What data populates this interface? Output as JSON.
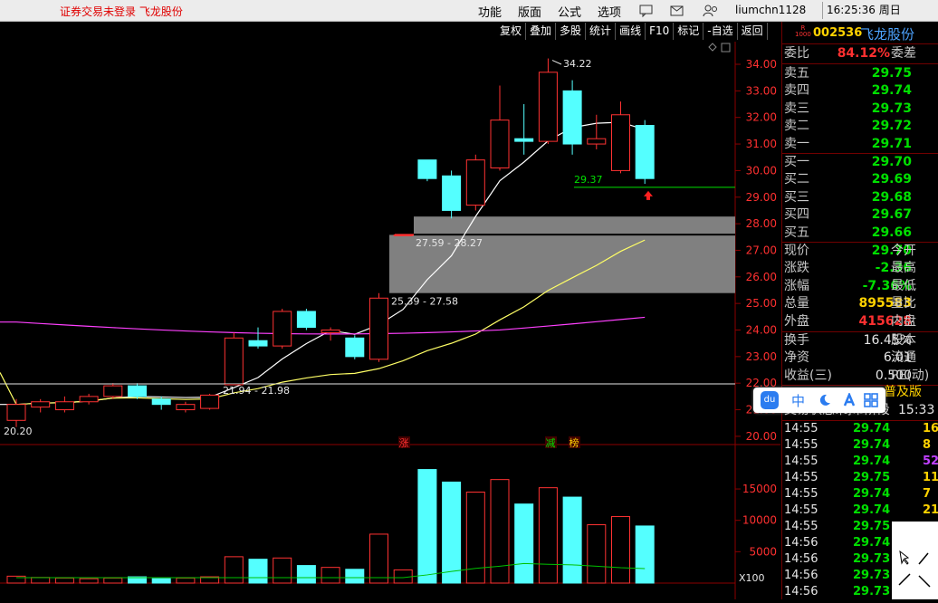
{
  "topbar": {
    "notice": "证券交易未登录",
    "stock_name": "飞龙股份",
    "menu": [
      "功能",
      "版面",
      "公式",
      "选项"
    ],
    "user": "liumchn1128",
    "time": "16:25:36",
    "weekday": "周日"
  },
  "toolbar": [
    "复权",
    "叠加",
    "多股",
    "统计",
    "画线",
    "F10",
    "标记",
    "-自选",
    "返回"
  ],
  "quote": {
    "badge_r": "R",
    "badge_num": "1000",
    "code": "002536",
    "name": "飞龙股份",
    "weibi_label": "委比",
    "weibi_value": "84.12%",
    "weicha_label": "委差",
    "asks": [
      {
        "label": "卖五",
        "price": "29.75"
      },
      {
        "label": "卖四",
        "price": "29.74"
      },
      {
        "label": "卖三",
        "price": "29.73"
      },
      {
        "label": "卖二",
        "price": "29.72"
      },
      {
        "label": "卖一",
        "price": "29.71"
      }
    ],
    "bids": [
      {
        "label": "买一",
        "price": "29.70"
      },
      {
        "label": "买二",
        "price": "29.69"
      },
      {
        "label": "买三",
        "price": "29.68"
      },
      {
        "label": "买四",
        "price": "29.67"
      },
      {
        "label": "买五",
        "price": "29.66"
      }
    ],
    "stats": [
      {
        "label": "现价",
        "value": "29.70",
        "label2": "今开",
        "color": "#00e000"
      },
      {
        "label": "涨跌",
        "value": "-2.36",
        "label2": "最高",
        "color": "#00e000"
      },
      {
        "label": "涨幅",
        "value": "-7.36%",
        "label2": "最低",
        "color": "#00e000"
      },
      {
        "label": "总量",
        "value": "895583",
        "label2": "量比",
        "color": "#ffd200"
      },
      {
        "label": "外盘",
        "value": "415628",
        "label2": "内盘",
        "color": "#ff3030"
      }
    ],
    "stats2": [
      {
        "label": "换手",
        "value": "16.45%",
        "label2": "股本"
      },
      {
        "label": "净资",
        "value": "6.01",
        "label2": "流通"
      },
      {
        "label": "收益(三)",
        "value": "0.500",
        "label2": "PE(动)"
      }
    ],
    "info_tail": "普及版",
    "trade_status": "交易状态:闭市阶段",
    "trade_time": "15:33"
  },
  "ticks": [
    {
      "time": "14:55",
      "price": "29.74",
      "vol": "16",
      "vcolor": "#ffd200"
    },
    {
      "time": "14:55",
      "price": "29.74",
      "vol": "8",
      "vcolor": "#ffd200"
    },
    {
      "time": "14:55",
      "price": "29.74",
      "vol": "52",
      "vcolor": "#c040ff"
    },
    {
      "time": "14:55",
      "price": "29.75",
      "vol": "11",
      "vcolor": "#ffd200"
    },
    {
      "time": "14:55",
      "price": "29.74",
      "vol": "7",
      "vcolor": "#ffd200"
    },
    {
      "time": "14:55",
      "price": "29.74",
      "vol": "21",
      "vcolor": "#ffd200"
    },
    {
      "time": "14:55",
      "price": "29.75",
      "vol": "",
      "vcolor": "#ffd200"
    },
    {
      "time": "14:56",
      "price": "29.74",
      "vol": "",
      "vcolor": "#ffd200"
    },
    {
      "time": "14:56",
      "price": "29.73",
      "vol": "",
      "vcolor": "#ffd200"
    },
    {
      "time": "14:56",
      "price": "29.73",
      "vol": "",
      "vcolor": "#ffd200"
    },
    {
      "time": "14:56",
      "price": "29.73",
      "vol": "",
      "vcolor": "#ffd200"
    }
  ],
  "ime": {
    "logo": "du",
    "lang": "中"
  },
  "chart_data": {
    "type": "candlestick",
    "price_axis_ticks": [
      "34.00",
      "33.00",
      "32.00",
      "31.00",
      "30.00",
      "29.00",
      "28.00",
      "27.00",
      "26.00",
      "25.00",
      "24.00",
      "23.00",
      "22.00",
      "21.00",
      "20.00"
    ],
    "volume_axis_ticks": [
      "15000",
      "10000",
      "5000"
    ],
    "volume_unit": "X100",
    "candles": [
      {
        "o": 20.6,
        "c": 21.2,
        "h": 21.4,
        "l": 20.35,
        "v": 1100
      },
      {
        "o": 21.1,
        "c": 21.3,
        "h": 21.4,
        "l": 20.9,
        "v": 900
      },
      {
        "o": 21.0,
        "c": 21.3,
        "h": 21.5,
        "l": 20.9,
        "v": 800
      },
      {
        "o": 21.3,
        "c": 21.5,
        "h": 21.6,
        "l": 21.2,
        "v": 700
      },
      {
        "o": 21.5,
        "c": 21.9,
        "h": 22.0,
        "l": 21.4,
        "v": 800
      },
      {
        "o": 21.9,
        "c": 21.5,
        "h": 22.0,
        "l": 21.4,
        "v": 1000
      },
      {
        "o": 21.4,
        "c": 21.2,
        "h": 21.5,
        "l": 21.0,
        "v": 700
      },
      {
        "o": 21.0,
        "c": 21.2,
        "h": 21.3,
        "l": 20.9,
        "v": 800
      },
      {
        "o": 21.05,
        "c": 21.55,
        "h": 21.6,
        "l": 21.0,
        "v": 1000
      },
      {
        "o": 21.94,
        "c": 23.7,
        "h": 23.9,
        "l": 21.98,
        "v": 4200
      },
      {
        "o": 23.6,
        "c": 23.4,
        "h": 24.1,
        "l": 23.3,
        "v": 3800
      },
      {
        "o": 23.4,
        "c": 24.7,
        "h": 24.8,
        "l": 23.3,
        "v": 4000
      },
      {
        "o": 24.7,
        "c": 24.1,
        "h": 24.8,
        "l": 24.0,
        "v": 2800
      },
      {
        "o": 23.9,
        "c": 24.0,
        "h": 24.1,
        "l": 23.6,
        "v": 2500
      },
      {
        "o": 23.7,
        "c": 23.0,
        "h": 23.8,
        "l": 22.9,
        "v": 2200
      },
      {
        "o": 22.9,
        "c": 25.2,
        "h": 25.39,
        "l": 22.8,
        "v": 7800
      },
      {
        "o": 27.58,
        "c": 27.58,
        "h": 27.59,
        "l": 27.58,
        "v": 2100
      },
      {
        "o": 30.4,
        "c": 29.7,
        "h": 30.4,
        "l": 29.6,
        "v": 18100
      },
      {
        "o": 29.8,
        "c": 28.5,
        "h": 30.0,
        "l": 28.2,
        "v": 16100
      },
      {
        "o": 28.7,
        "c": 30.4,
        "h": 30.6,
        "l": 28.5,
        "v": 14500
      },
      {
        "o": 30.1,
        "c": 31.9,
        "h": 33.2,
        "l": 30.0,
        "v": 16500
      },
      {
        "o": 31.2,
        "c": 31.1,
        "h": 32.5,
        "l": 30.6,
        "v": 12600
      },
      {
        "o": 31.1,
        "c": 33.7,
        "h": 34.22,
        "l": 31.0,
        "v": 15200
      },
      {
        "o": 33.0,
        "c": 31.0,
        "h": 33.4,
        "l": 30.6,
        "v": 13700
      },
      {
        "o": 31.0,
        "c": 31.2,
        "h": 32.1,
        "l": 30.8,
        "v": 9300
      },
      {
        "o": 30.0,
        "c": 32.1,
        "h": 32.6,
        "l": 29.9,
        "v": 10600
      },
      {
        "o": 31.7,
        "c": 29.7,
        "h": 31.9,
        "l": 29.5,
        "v": 9100
      }
    ],
    "annotations": [
      "34.22",
      "29.37",
      "27.59 - 28.27",
      "25.39 - 27.58",
      "21.94 - 21.98",
      "20.20"
    ],
    "markers": [
      "涨",
      "减",
      "榜"
    ]
  },
  "colors": {
    "up": "#ff3232",
    "down": "#54ffff",
    "ma_white": "#ffffff",
    "ma_yellow": "#ffff66",
    "ma_magenta": "#ff40ff",
    "gap": "#808080"
  }
}
